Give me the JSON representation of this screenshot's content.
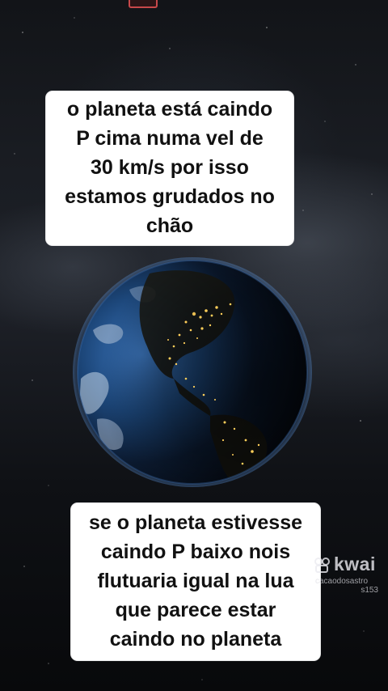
{
  "video": {
    "caption_top": "o planeta está caindo\nP cima numa vel de\n30 km/s por isso\nestamos grudados no\nchão",
    "caption_bottom": "se o planeta estivesse\ncaindo P baixo nois\nflutuaria igual na lua\nque parece estar\ncaindo no planeta"
  },
  "watermark": {
    "brand": "kwai",
    "username": "cacaodosastro",
    "id": "s153",
    "icon": "kwai-logo-icon"
  },
  "colors": {
    "caption_bg": "#ffffff",
    "caption_text": "#111111",
    "space_bg": "#0a0c10",
    "ocean": "#1f4f8a",
    "city_lights": "#ffcf5a"
  }
}
